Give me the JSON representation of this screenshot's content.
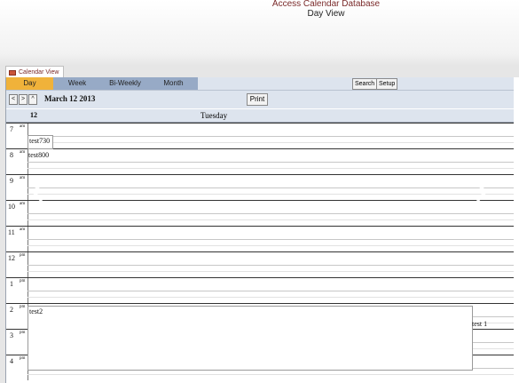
{
  "header": {
    "app_title": "Access Calendar Database",
    "view_title": "Day View"
  },
  "document_tab": {
    "label": "Calendar View",
    "icon": "form-icon"
  },
  "view_tabs": [
    {
      "label": "Day",
      "active": true
    },
    {
      "label": "Week",
      "active": false
    },
    {
      "label": "Bi-Weekly",
      "active": false
    },
    {
      "label": "Month",
      "active": false
    }
  ],
  "toolbar": {
    "search_label": "Search",
    "setup_label": "Setup",
    "print_label": "Print"
  },
  "nav": {
    "prev": "<",
    "next": ">",
    "up": "^"
  },
  "date_label": "March 12 2013",
  "day_header": {
    "day_number": "12",
    "day_name": "Tuesday"
  },
  "hours": [
    {
      "hour": "7",
      "ampm": "am"
    },
    {
      "hour": "8",
      "ampm": "am"
    },
    {
      "hour": "9",
      "ampm": "am"
    },
    {
      "hour": "10",
      "ampm": "am"
    },
    {
      "hour": "11",
      "ampm": "am"
    },
    {
      "hour": "12",
      "ampm": "pm"
    },
    {
      "hour": "1",
      "ampm": "pm"
    },
    {
      "hour": "2",
      "ampm": "pm"
    },
    {
      "hour": "3",
      "ampm": "pm"
    },
    {
      "hour": "4",
      "ampm": "pm"
    }
  ],
  "events": {
    "test730": "test730",
    "test800": "test800",
    "test2": "test2",
    "test1": "test 1"
  },
  "colors": {
    "active_tab": "#f0b23a",
    "inactive_tab": "#97aac6",
    "bar_bg": "#dde4ee",
    "title_accent": "#7a2a2a"
  }
}
